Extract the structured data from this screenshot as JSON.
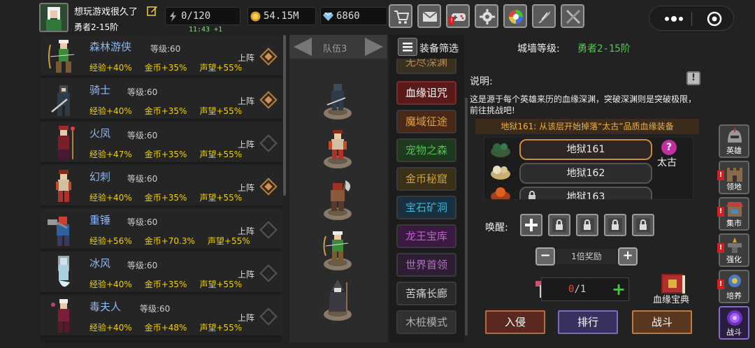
{
  "player": {
    "name": "想玩游戏很久了",
    "rank": "勇者2-15阶"
  },
  "resources": {
    "stamina": "0/120",
    "stamina_timer": "11:43 +1",
    "gold": "54.15M",
    "gems": "6860"
  },
  "heroes": [
    {
      "name": "森林游侠",
      "level": "等级:60",
      "exp": "经验+40%",
      "gold": "金币+35%",
      "fame": "声望+55%",
      "action": "上阵",
      "active": true
    },
    {
      "name": "骑士",
      "level": "等级:60",
      "exp": "经验+40%",
      "gold": "金币+35%",
      "fame": "声望+55%",
      "action": "上阵",
      "active": true
    },
    {
      "name": "火凤",
      "level": "等级:60",
      "exp": "经验+47%",
      "gold": "金币+35%",
      "fame": "声望+55%",
      "action": "上阵",
      "active": false
    },
    {
      "name": "幻刺",
      "level": "等级:60",
      "exp": "经验+40%",
      "gold": "金币+35%",
      "fame": "声望+55%",
      "action": "上阵",
      "active": true
    },
    {
      "name": "重锤",
      "level": "等级:60",
      "exp": "经验+56%",
      "gold": "金币+70.3%",
      "fame": "声望+55%",
      "action": "上阵",
      "active": false
    },
    {
      "name": "冰风",
      "level": "等级:60",
      "exp": "经验+40%",
      "gold": "金币+35%",
      "fame": "声望+55%",
      "action": "上阵",
      "active": false
    },
    {
      "name": "毒夫人",
      "level": "等级:60",
      "exp": "经验+40%",
      "gold": "金币+48%",
      "fame": "声望+55%",
      "action": "上阵",
      "active": false
    }
  ],
  "team": {
    "label": "队伍3"
  },
  "categories": [
    {
      "label": "无尽深渊",
      "color": "#b08a5a"
    },
    {
      "label": "血缘诅咒",
      "color": "#ffffff"
    },
    {
      "label": "魔域征途",
      "color": "#e0a040"
    },
    {
      "label": "宠物之森",
      "color": "#50c050"
    },
    {
      "label": "金币秘窟",
      "color": "#d0a030"
    },
    {
      "label": "宝石矿洞",
      "color": "#40b0d0"
    },
    {
      "label": "龙王宝库",
      "color": "#c060d0"
    },
    {
      "label": "世界首领",
      "color": "#b070c0"
    },
    {
      "label": "苦痛长廊",
      "color": "#d0d0d0"
    },
    {
      "label": "木桩模式",
      "color": "#b0b0b0"
    }
  ],
  "header": {
    "filter": "装备筛选",
    "wall_label": "城墙等级:",
    "wall_value": "勇者2-15阶"
  },
  "detail": {
    "title": "说明:",
    "help": "!",
    "description": "这是源于每个英雄来历的血缘深渊，突破深渊则是突破极限，前往挑战吧!",
    "drop_info": "地狱161: 从该层开始掉落“太古”品质血缘装备",
    "floors": [
      "地狱161",
      "地狱162",
      "地狱163"
    ],
    "quality_mark": "?",
    "quality": "太古",
    "awaken_label": "唤醒:",
    "multiplier": "1倍奖励",
    "ticket_count": "0",
    "ticket_max": "/1",
    "codex": "血缘宝典",
    "actions": [
      "入侵",
      "排行",
      "战斗"
    ]
  },
  "nav": [
    {
      "label": "英雄",
      "badge": false
    },
    {
      "label": "领地",
      "badge": true
    },
    {
      "label": "集市",
      "badge": true
    },
    {
      "label": "强化",
      "badge": true
    },
    {
      "label": "培养",
      "badge": true
    },
    {
      "label": "战斗",
      "badge": false
    }
  ]
}
